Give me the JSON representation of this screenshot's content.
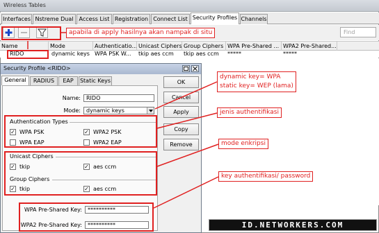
{
  "window": {
    "title": "Wireless Tables"
  },
  "tabs": [
    "Interfaces",
    "Nstreme Dual",
    "Access List",
    "Registration",
    "Connect List",
    "Security Profiles",
    "Channels"
  ],
  "active_tab": "Security Profiles",
  "toolbar": {
    "find_placeholder": "Find"
  },
  "table": {
    "headers": [
      "Name",
      "Mode",
      "Authenticatio...",
      "Unicast Ciphers",
      "Group Ciphers",
      "WPA Pre-Shared ...",
      "WPA2 Pre-Shared..."
    ],
    "row": [
      "RIDO",
      "dynamic keys",
      "WPA PSK W...",
      "tkip aes ccm",
      "tkip aes ccm",
      "*****",
      "*****"
    ]
  },
  "dialog": {
    "title": "Security Profile <RIDO>",
    "tabs": [
      "General",
      "RADIUS",
      "EAP",
      "Static Keys"
    ],
    "name_label": "Name:",
    "name_value": "RIDO",
    "mode_label": "Mode:",
    "mode_value": "dynamic keys",
    "auth_section": "Authentication Types",
    "auth": {
      "wpa_psk": "WPA PSK",
      "wpa2_psk": "WPA2 PSK",
      "wpa_eap": "WPA EAP",
      "wpa2_eap": "WPA2 EAP"
    },
    "unicast_section": "Unicast Ciphers",
    "group_section": "Group Ciphers",
    "ciphers": {
      "tkip": "tkip",
      "aes": "aes ccm"
    },
    "wpa_key_label": "WPA Pre-Shared Key:",
    "wpa_key_value": "**********",
    "wpa2_key_label": "WPA2 Pre-Shared Key:",
    "wpa2_key_value": "**********",
    "buttons": {
      "ok": "OK",
      "cancel": "Cancel",
      "apply": "Apply",
      "copy": "Copy",
      "remove": "Remove"
    }
  },
  "annotations": {
    "apply_note": "apabila di apply hasilnya akan nampak di situ",
    "mode_note_1": "dynamic key= WPA",
    "mode_note_2": "static key= WEP (lama)",
    "auth_note": "jenis authentifikasi",
    "cipher_note": "mode enkripsi",
    "key_note": "key authentifikasi/ password"
  },
  "watermark": "ID.NETWORKERS.COM",
  "colors": {
    "annotation": "#e02020",
    "tab_active": "#ffffff",
    "toolbar_add": "#1a47c8"
  }
}
